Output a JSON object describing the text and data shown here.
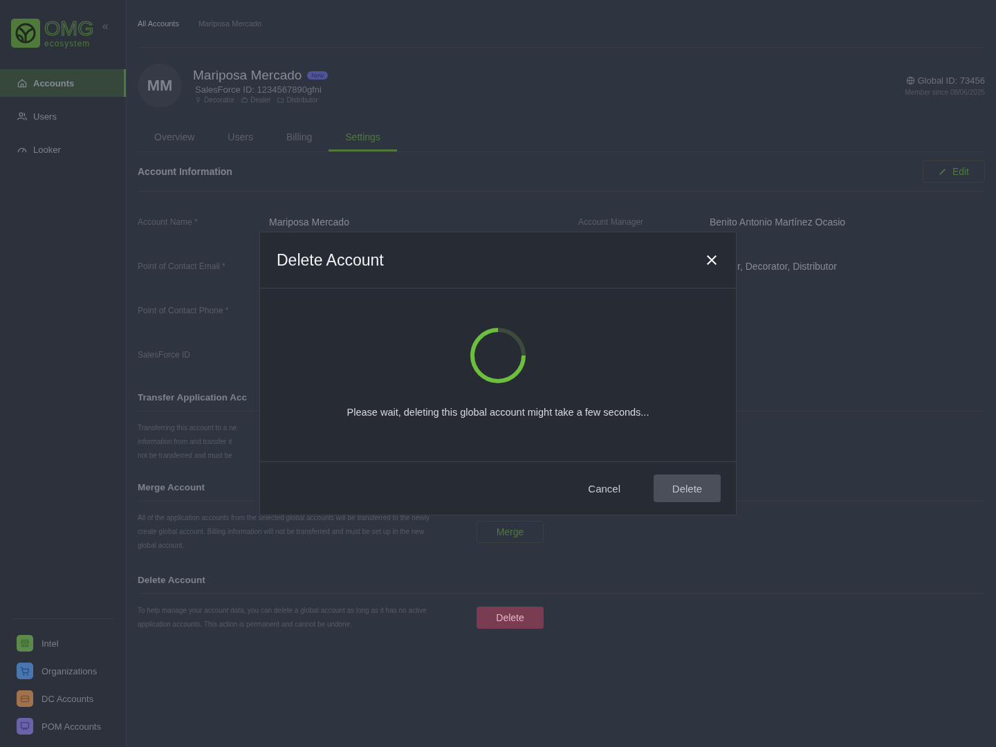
{
  "sidebar": {
    "logo": {
      "wordmark": "OMG",
      "tagline": "ecosystem"
    },
    "collapse": "«",
    "nav": [
      {
        "kind": "home",
        "label": "Accounts",
        "selected": true
      },
      {
        "kind": "users",
        "label": "Users",
        "selected": false
      },
      {
        "kind": "gauge",
        "label": "Looker",
        "selected": false
      }
    ],
    "apps": [
      {
        "kind": "store",
        "label": "Intel",
        "color": "#5b8a4a"
      },
      {
        "kind": "cart",
        "label": "Organizations",
        "color": "#4a76b0"
      },
      {
        "kind": "box",
        "label": "DC Accounts",
        "color": "#a0724e"
      },
      {
        "kind": "screen",
        "label": "POM Accounts",
        "color": "#6a63a8"
      }
    ]
  },
  "breadcrumb": [
    "All Accounts",
    "Mariposa Mercado"
  ],
  "account": {
    "initials": "MM",
    "name": "Mariposa Mercado",
    "badge": "New",
    "salesforce": "SalesForce ID: 1234567890gfni",
    "roles": [
      {
        "kind": "pin",
        "label": "Decorator"
      },
      {
        "kind": "briefcase",
        "label": "Dealer"
      },
      {
        "kind": "folder",
        "label": "Distributor"
      }
    ],
    "global_id": "Global ID: 73456",
    "member_since": "Member since 08/06/2025"
  },
  "tabs": [
    {
      "label": "Overview",
      "selected": false
    },
    {
      "label": "Users",
      "selected": false
    },
    {
      "label": "Billing",
      "selected": false
    },
    {
      "label": "Settings",
      "selected": true
    }
  ],
  "account_information": {
    "title": "Account Information",
    "edit": "Edit",
    "fields": [
      {
        "label": "Account Name *",
        "value": "Mariposa Mercado",
        "right_label": "Account Manager",
        "right_value": "Benito Antonio Martínez Ocasio"
      },
      {
        "label": "Point of Contact Email *",
        "right_value": "r, Decorator, Distributor"
      },
      {
        "label": "Point of Contact Phone *"
      },
      {
        "label": "SalesForce ID"
      }
    ]
  },
  "transfer": {
    "title": "Transfer Application Acc",
    "lines": [
      "Transferring this account to a ne",
      "information from and transfer it",
      "not be transferred and must be"
    ]
  },
  "merge": {
    "title": "Merge Account",
    "text": "All of the application accounts from the selected global accounts will be transferred to the newly create global account. Billing information will not be transferred and must be set up in the new global account.",
    "button": "Merge"
  },
  "delete": {
    "title": "Delete Account",
    "text": "To help manage your account data, you can delete a global account as long as it has no active application accounts. This action is permanent and cannot be undone.",
    "button": "Delete"
  },
  "modal": {
    "title": "Delete Account",
    "message": "Please wait, deleting this global account might take a few seconds...",
    "cancel": "Cancel",
    "confirm": "Delete",
    "confirm_disabled": true
  }
}
